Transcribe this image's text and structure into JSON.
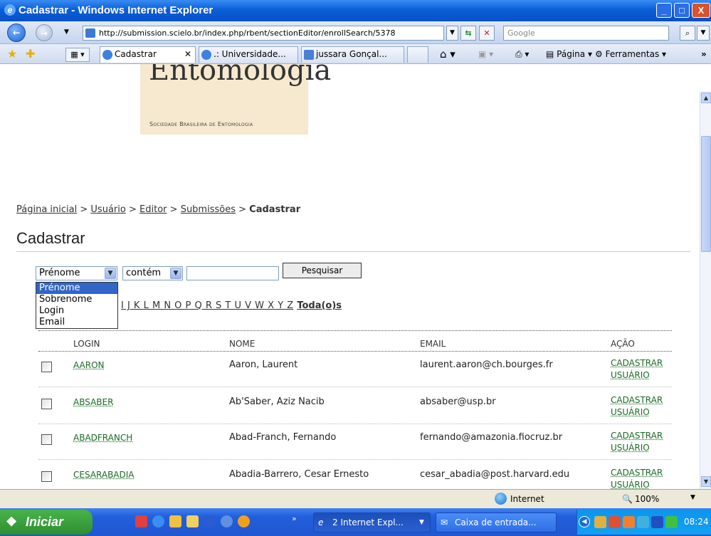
{
  "window": {
    "title": "Cadastrar - Windows Internet Explorer",
    "minimize": "_",
    "maximize": "□",
    "close": "X"
  },
  "browser": {
    "url": "http://submission.scielo.br/index.php/rbent/sectionEditor/enrollSearch/5378",
    "search_placeholder": "Google",
    "tabs": [
      {
        "label": "Cadastrar",
        "active": true
      },
      {
        "label": ".: Universidade...",
        "active": false
      },
      {
        "label": "jussara Gonçal...",
        "active": false
      }
    ],
    "tools": {
      "page": "Página",
      "tools": "Ferramentas"
    }
  },
  "logo": {
    "title": "Entomologia",
    "subtitle": "Sociedade Brasileira de Entomologia"
  },
  "breadcrumb": {
    "items": [
      "Página inicial",
      "Usuário",
      "Editor",
      "Submissões"
    ],
    "current": "Cadastrar",
    "separator": ">"
  },
  "page_title": "Cadastrar",
  "search": {
    "field_selected": "Prénome",
    "field_options": [
      "Prénome",
      "Sobrenome",
      "Login",
      "Email"
    ],
    "match_selected": "contém",
    "value": "",
    "button": "Pesquisar"
  },
  "alphabet": {
    "letters": "I J K L M N O P Q R S T U V W X Y Z",
    "all": "Toda(o)s"
  },
  "table": {
    "headers": {
      "login": "LOGIN",
      "name": "NOME",
      "email": "EMAIL",
      "action": "AÇÃO"
    },
    "action_line1": "CADASTRAR",
    "action_line2": "USUÁRIO",
    "rows": [
      {
        "login": "AARON",
        "name": "Aaron, Laurent",
        "email": "laurent.aaron@ch.bourges.fr"
      },
      {
        "login": "ABSABER",
        "name": "Ab'Saber, Aziz Nacib",
        "email": "absaber@usp.br"
      },
      {
        "login": "ABADFRANCH",
        "name": "Abad-Franch, Fernando",
        "email": "fernando@amazonia.fiocruz.br"
      },
      {
        "login": "CESARABADIA",
        "name": "Abadia-Barrero, Cesar Ernesto",
        "email": "cesar_abadia@post.harvard.edu"
      }
    ]
  },
  "status": {
    "zone": "Internet",
    "zoom": "100%"
  },
  "taskbar": {
    "start": "Iniciar",
    "tasks": [
      {
        "label": "2 Internet Expl..."
      },
      {
        "label": "Caixa de entrada..."
      }
    ],
    "clock": "08:24"
  }
}
